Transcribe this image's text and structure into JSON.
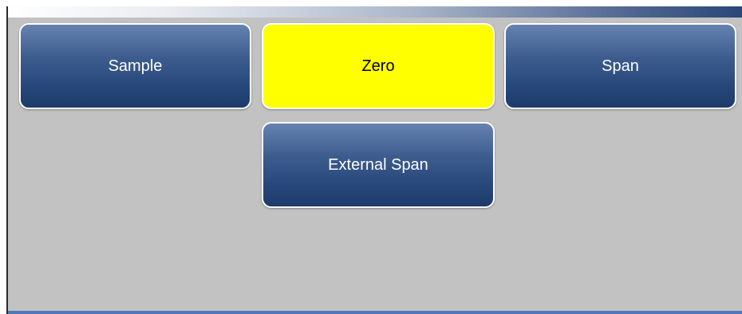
{
  "menu": {
    "buttons": [
      {
        "label": "Sample",
        "state": "normal"
      },
      {
        "label": "Zero",
        "state": "selected"
      },
      {
        "label": "Span",
        "state": "normal"
      },
      {
        "label": "External Span",
        "state": "normal"
      }
    ]
  },
  "colors": {
    "button_blue": "#27477a",
    "selected_yellow": "#ffff00",
    "panel_gray": "#c2c2c2",
    "bottom_accent": "#4d79b8"
  }
}
